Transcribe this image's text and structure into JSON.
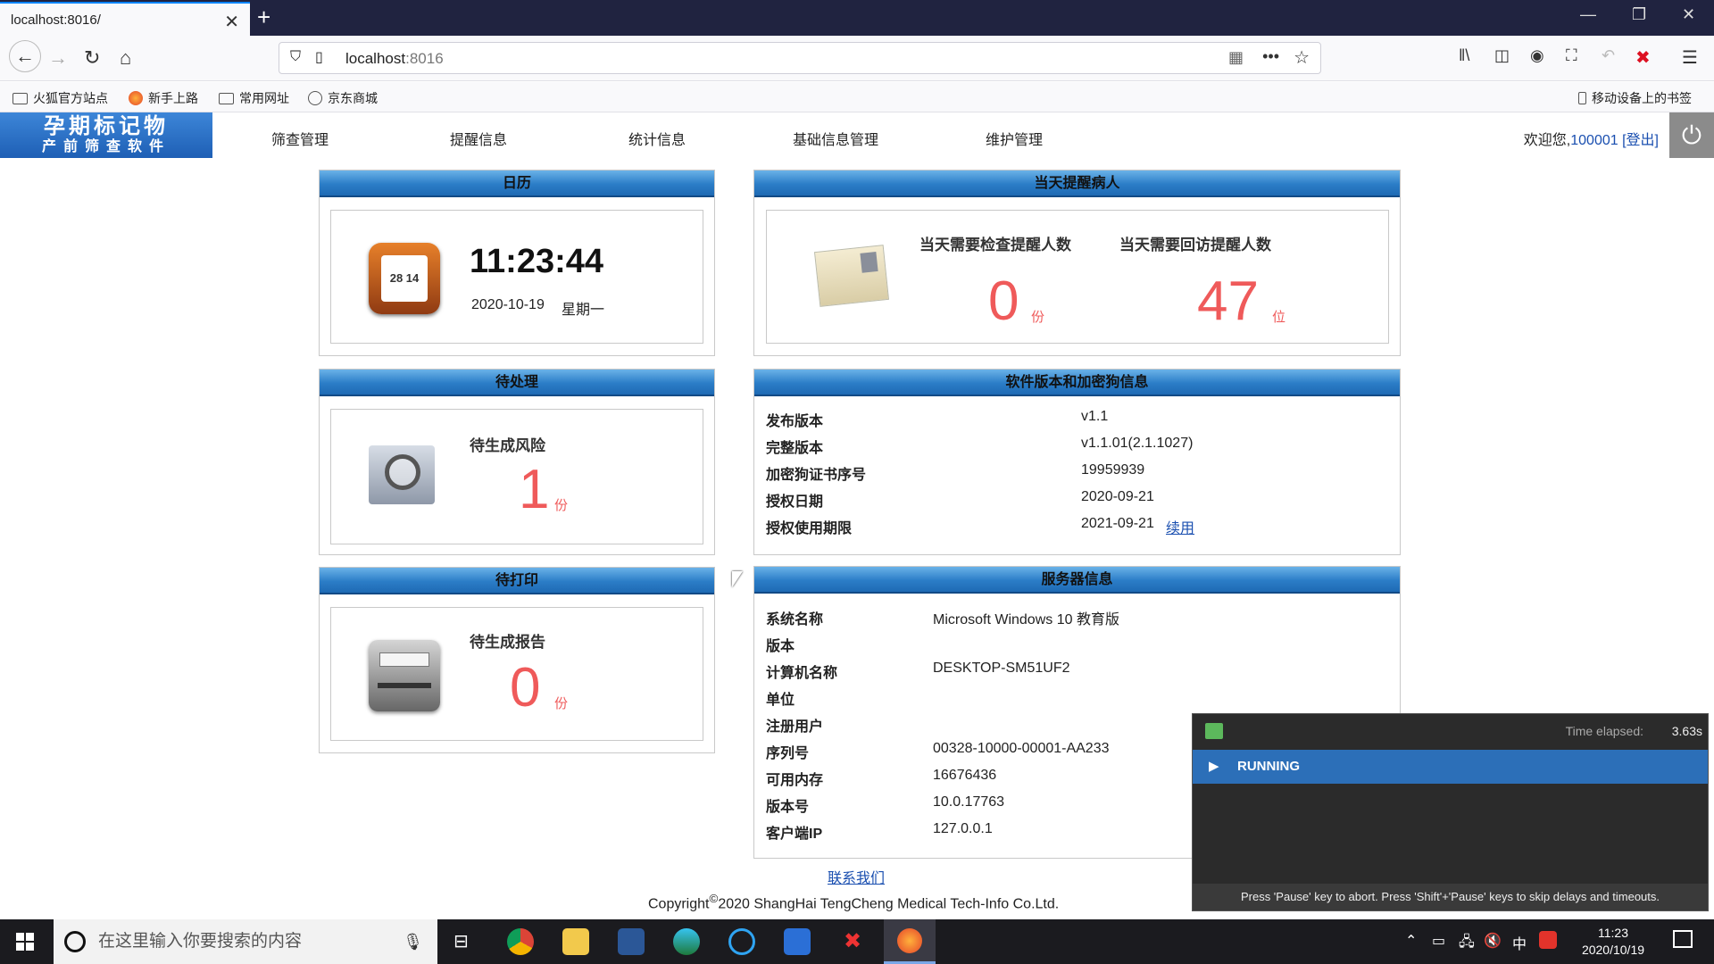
{
  "browser": {
    "tab_title": "localhost:8016/",
    "url_host": "localhost",
    "url_port": ":8016",
    "bookmarks": [
      "火狐官方站点",
      "新手上路",
      "常用网址",
      "京东商城"
    ],
    "mobile_bookmarks": "移动设备上的书签"
  },
  "app": {
    "logo_line1": "孕期标记物",
    "logo_line2": "产前筛查软件",
    "menu": [
      "筛查管理",
      "提醒信息",
      "统计信息",
      "基础信息管理",
      "维护管理"
    ],
    "welcome_prefix": "欢迎您,",
    "user_id": "100001",
    "logout": "[登出]"
  },
  "calendar": {
    "title": "日历",
    "time": "11:23:44",
    "date": "2020-10-19",
    "weekday": "星期一"
  },
  "reminders": {
    "title": "当天提醒病人",
    "check_label": "当天需要检查提醒人数",
    "check_value": "0",
    "check_unit": "份",
    "followup_label": "当天需要回访提醒人数",
    "followup_value": "47",
    "followup_unit": "位"
  },
  "pending": {
    "title": "待处理",
    "label": "待生成风险",
    "value": "1",
    "unit": "份"
  },
  "printing": {
    "title": "待打印",
    "label": "待生成报告",
    "value": "0",
    "unit": "份"
  },
  "version": {
    "title": "软件版本和加密狗信息",
    "rows": [
      {
        "k": "发布版本",
        "v": "v1.1"
      },
      {
        "k": "完整版本",
        "v": "v1.1.01(2.1.1027)"
      },
      {
        "k": "加密狗证书序号",
        "v": "19959939"
      },
      {
        "k": "授权日期",
        "v": "2020-09-21"
      },
      {
        "k": "授权使用期限",
        "v": "2021-09-21"
      }
    ],
    "renew": "续用"
  },
  "server": {
    "title": "服务器信息",
    "rows": [
      {
        "k": "系统名称",
        "v": "Microsoft Windows 10 教育版"
      },
      {
        "k": "版本",
        "v": ""
      },
      {
        "k": "计算机名称",
        "v": "DESKTOP-SM51UF2"
      },
      {
        "k": "单位",
        "v": ""
      },
      {
        "k": "注册用户",
        "v": ""
      },
      {
        "k": "序列号",
        "v": "00328-10000-00001-AA233"
      },
      {
        "k": "可用内存",
        "v": "16676436"
      },
      {
        "k": "版本号",
        "v": "10.0.17763"
      },
      {
        "k": "客户端IP",
        "v": "127.0.0.1"
      }
    ]
  },
  "footer": {
    "contact": "联系我们",
    "copyright_pre": "Copyright",
    "copyright_sym": "©",
    "copyright_rest": "2020 ShangHai TengCheng Medical Tech-Info Co.Ltd."
  },
  "runner": {
    "time_label": "Time elapsed:",
    "time_value": "3.63s",
    "status": "RUNNING",
    "hint": "Press 'Pause' key to abort. Press 'Shift'+'Pause' keys to skip delays and timeouts."
  },
  "taskbar": {
    "search_placeholder": "在这里输入你要搜索的内容",
    "clock_time": "11:23",
    "clock_date": "2020/10/19",
    "ime": "中"
  },
  "colors": {
    "accent": "#2b7dc7",
    "number": "#ef5a5a",
    "link": "#1a4fb0"
  }
}
